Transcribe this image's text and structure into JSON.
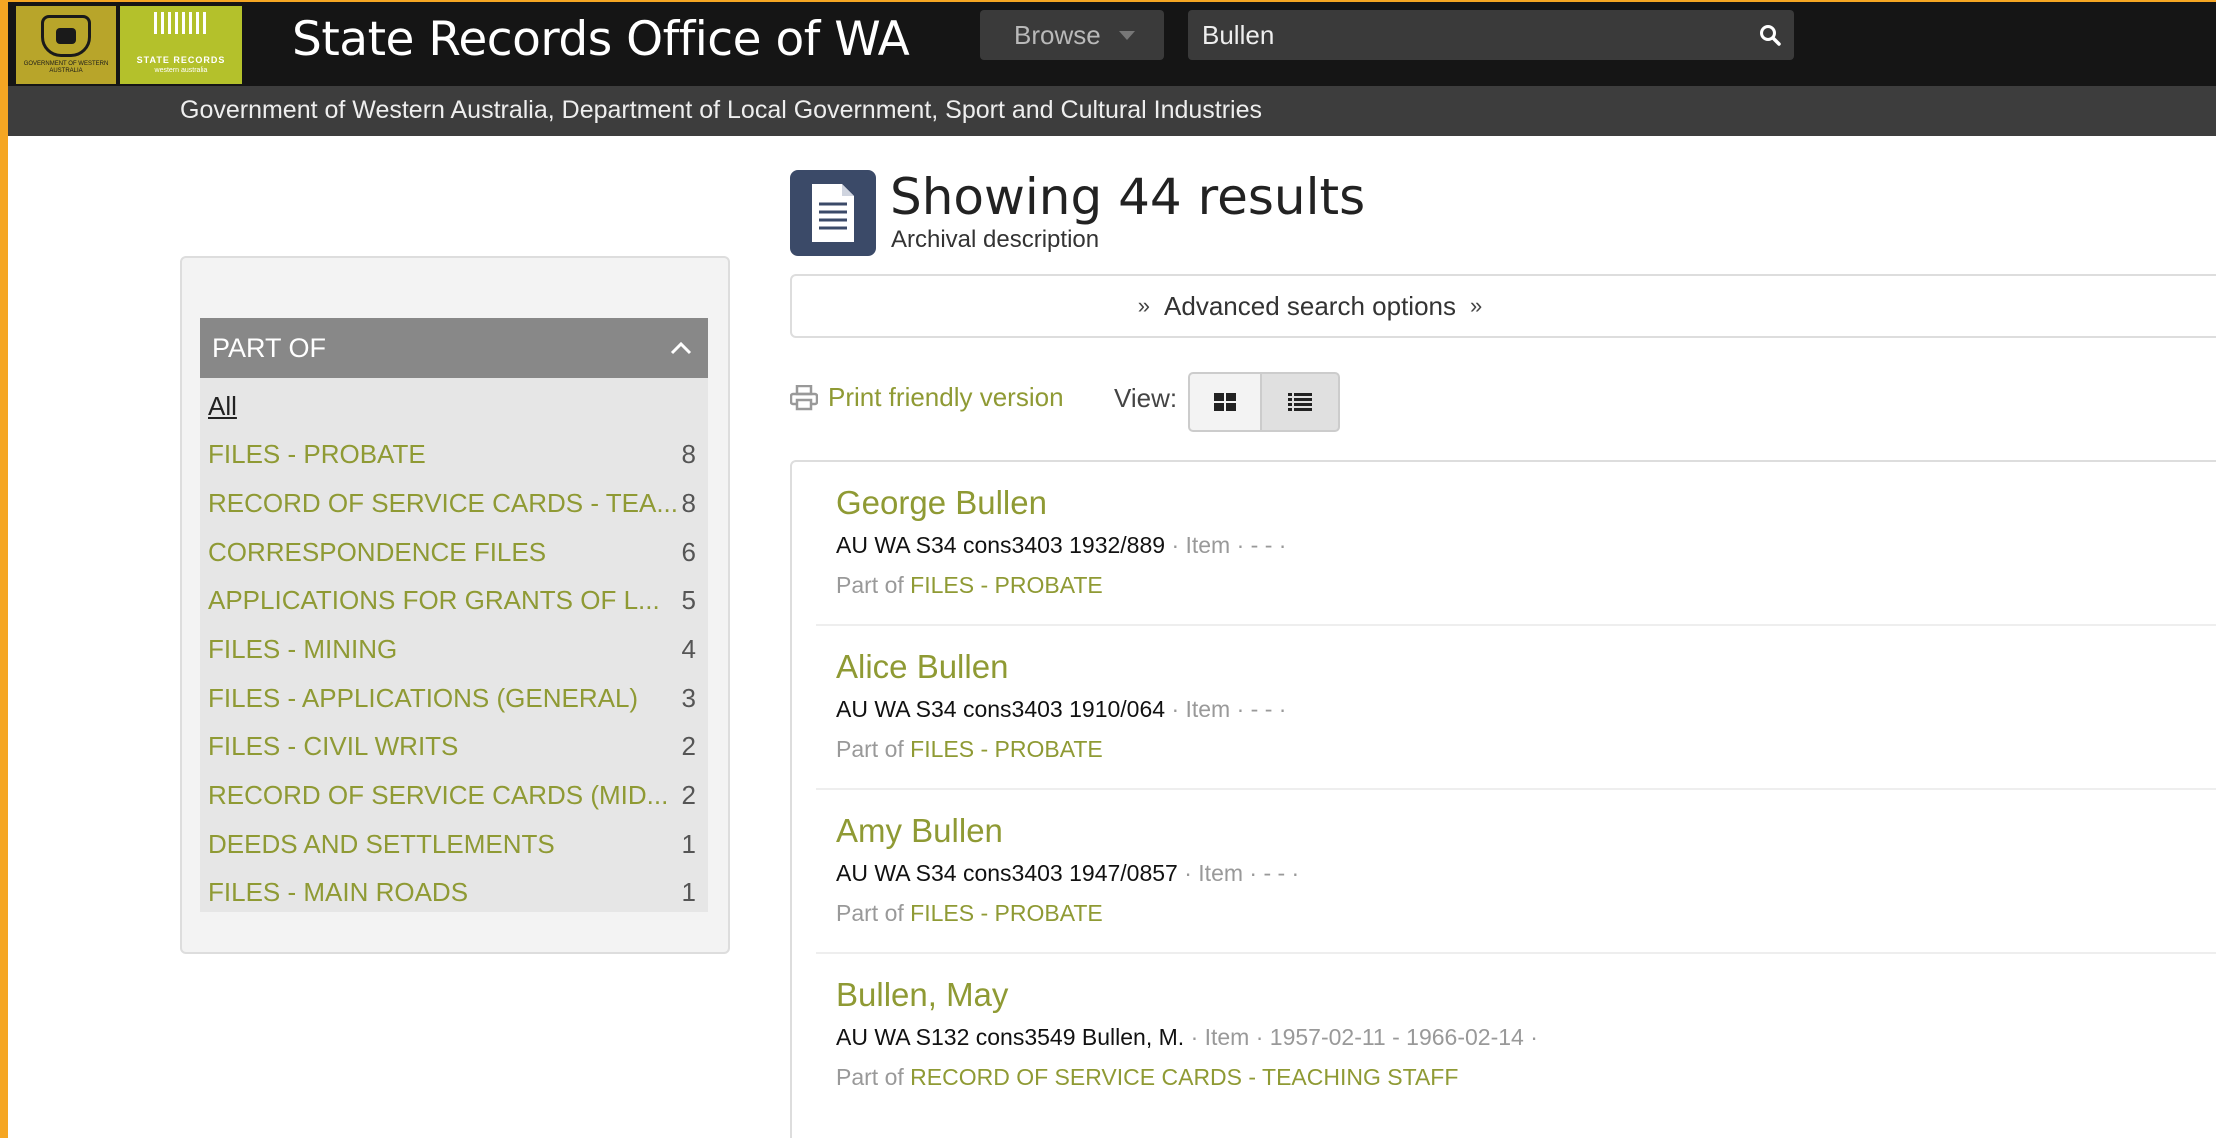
{
  "header": {
    "gov_logo_text": "GOVERNMENT OF WESTERN AUSTRALIA",
    "sro_logo_text": "STATE RECORDS",
    "sro_logo_sub": "western australia",
    "site_title": "State Records Office of WA",
    "browse_label": "Browse",
    "search_value": "Bullen",
    "subtitle": "Government of Western Australia, Department of Local Government, Sport and Cultural Industries"
  },
  "results_header": {
    "title": "Showing 44 results",
    "subtitle": "Archival description"
  },
  "advanced_search_label": "Advanced search options",
  "toolbar": {
    "print_label": "Print friendly version",
    "view_label": "View:"
  },
  "facet": {
    "title": "PART OF",
    "all_label": "All",
    "items": [
      {
        "label": "FILES - PROBATE",
        "count": "8"
      },
      {
        "label": "RECORD OF SERVICE CARDS - TEA...",
        "count": "8"
      },
      {
        "label": "CORRESPONDENCE FILES",
        "count": "6"
      },
      {
        "label": "APPLICATIONS FOR GRANTS OF L...",
        "count": "5"
      },
      {
        "label": "FILES - MINING",
        "count": "4"
      },
      {
        "label": "FILES - APPLICATIONS (GENERAL)",
        "count": "3"
      },
      {
        "label": "FILES - CIVIL WRITS",
        "count": "2"
      },
      {
        "label": "RECORD OF SERVICE CARDS (MID...",
        "count": "2"
      },
      {
        "label": "DEEDS AND SETTLEMENTS",
        "count": "1"
      },
      {
        "label": "FILES - MAIN ROADS",
        "count": "1"
      }
    ]
  },
  "results": [
    {
      "title": "George Bullen",
      "ref": "AU WA S34 cons3403 1932/889",
      "meta": "·  Item ·  -  - ·",
      "part_prefix": "Part of",
      "part_link": "FILES - PROBATE"
    },
    {
      "title": "Alice Bullen",
      "ref": "AU WA S34 cons3403 1910/064",
      "meta": "·  Item ·  -  - ·",
      "part_prefix": "Part of",
      "part_link": "FILES - PROBATE"
    },
    {
      "title": "Amy Bullen",
      "ref": "AU WA S34 cons3403 1947/0857",
      "meta": "·  Item ·  -  - ·",
      "part_prefix": "Part of",
      "part_link": "FILES - PROBATE"
    },
    {
      "title": "Bullen, May",
      "ref": "AU WA S132 cons3549 Bullen, M.",
      "meta": "·  Item ·  1957-02-11 - 1966-02-14 ·",
      "part_prefix": "Part of",
      "part_link": "RECORD OF SERVICE CARDS - TEACHING STAFF"
    }
  ],
  "colors": {
    "accent_green": "#8f9a34",
    "header_dark": "#151515",
    "subbar": "#3d3d3d",
    "facet_head": "#888888"
  }
}
